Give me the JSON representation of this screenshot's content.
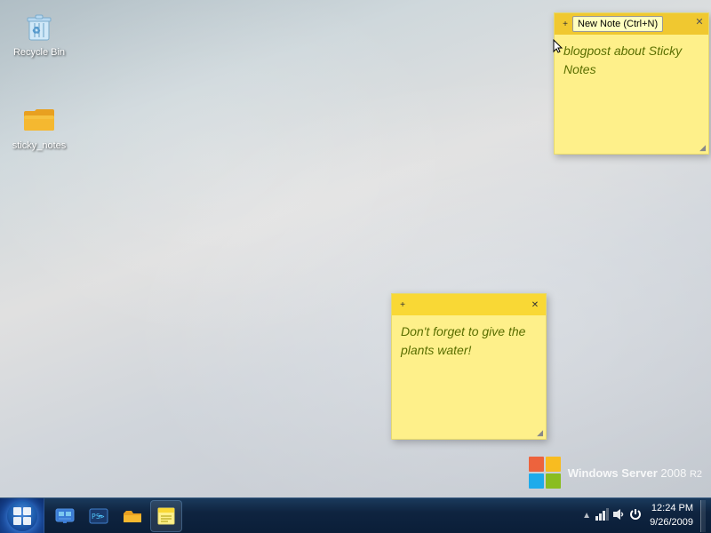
{
  "desktop": {
    "background_color": "#b8c4cc"
  },
  "icons": {
    "recycle_bin": {
      "label": "Recycle Bin",
      "id": "recycle-bin"
    },
    "sticky_notes": {
      "label": "sticky_notes",
      "id": "sticky-notes-folder"
    }
  },
  "notes": {
    "main_note": {
      "content": "Don't forget to give the plants water!"
    },
    "top_note": {
      "content": "blogpost about Sticky Notes"
    }
  },
  "tooltip": {
    "new_note": "New Note (Ctrl+N)"
  },
  "watermark": {
    "text": "Windows Server",
    "version": "2008",
    "release": "R2"
  },
  "taskbar": {
    "clock": {
      "time": "12:24 PM",
      "date": "9/26/2009"
    },
    "start_label": "Start",
    "icons": [
      {
        "name": "server-manager",
        "symbol": "🖥"
      },
      {
        "name": "powershell",
        "symbol": "🔵"
      },
      {
        "name": "folder-explorer",
        "symbol": "📁"
      },
      {
        "name": "sticky-notes-taskbar",
        "symbol": "📝"
      }
    ]
  }
}
